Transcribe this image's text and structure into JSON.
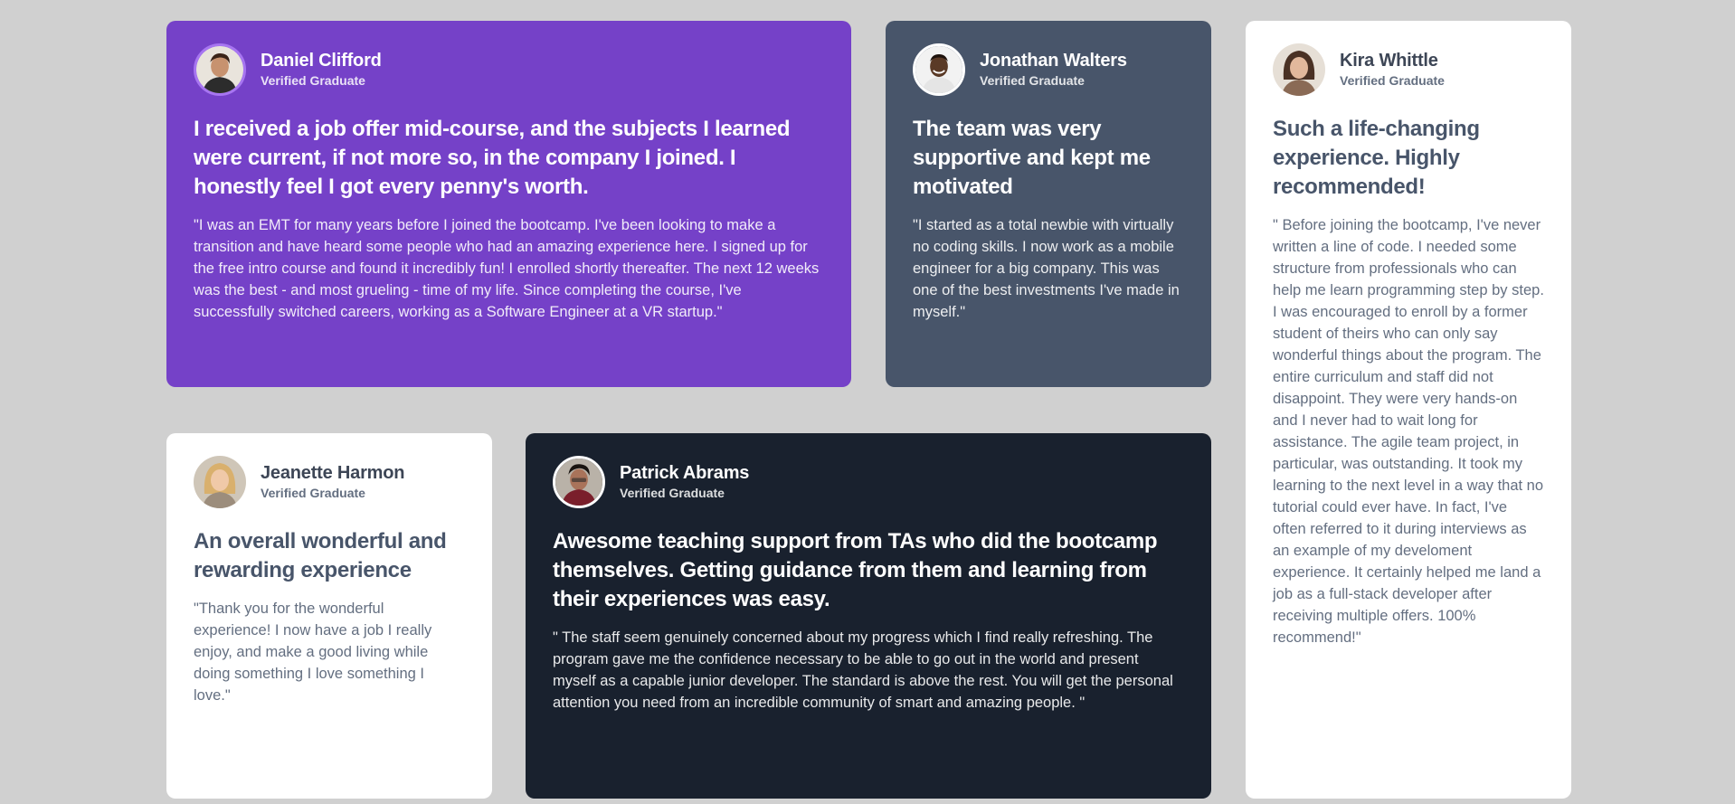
{
  "testimonials": {
    "daniel": {
      "name": "Daniel Clifford",
      "status": "Verified Graduate",
      "headline": "I received a job offer mid-course, and the subjects I learned were current, if not more so, in the company I joined. I honestly feel I got every penny's worth.",
      "quote": "\"I was an EMT for many years before I joined the bootcamp. I've been looking to make a transition and have heard some people who had an amazing experience here. I signed up for the free intro course and found it incredibly fun! I enrolled shortly thereafter. The next 12 weeks was the best - and most grueling - time of my life. Since completing the course, I've successfully switched careers, working as a Software Engineer at a VR startup.\"",
      "avatar_icon": "person-avatar-icon"
    },
    "jonathan": {
      "name": "Jonathan Walters",
      "status": "Verified Graduate",
      "headline": "The team was very supportive and kept me motivated",
      "quote": "\"I started as a total newbie with virtually no coding skills. I now work as a mobile engineer for a big company. This was one of the best investments I've made in myself.\"",
      "avatar_icon": "person-avatar-icon"
    },
    "kira": {
      "name": "Kira Whittle",
      "status": "Verified Graduate",
      "headline": "Such a life-changing experience. Highly recommended!",
      "quote": "\" Before joining the bootcamp, I've never written a line of code. I needed some structure from professionals who can help me learn programming step by step. I was encouraged to enroll by a former student of theirs who can only say wonderful things about the program. The entire curriculum and staff did not disappoint. They were very hands-on and I never had to wait long for assistance. The agile team project, in particular, was outstanding. It took my learning to the next level in a way that no tutorial could ever have. In fact, I've often referred to it during interviews as an example of my develoment experience. It certainly helped me land a job as a full-stack developer after receiving multiple offers. 100% recommend!\"",
      "avatar_icon": "person-avatar-icon"
    },
    "jeanette": {
      "name": "Jeanette Harmon",
      "status": "Verified Graduate",
      "headline": "An overall wonderful and rewarding experience",
      "quote": "\"Thank you for the wonderful experience! I now have a job I really enjoy, and make a good living while doing something I love something I love.\"",
      "avatar_icon": "person-avatar-icon"
    },
    "patrick": {
      "name": "Patrick Abrams",
      "status": "Verified Graduate",
      "headline": "Awesome teaching support from TAs who did the bootcamp themselves. Getting guidance from them and learning from their experiences was easy.",
      "quote": "\" The staff seem genuinely concerned about my progress which I find really refreshing. The program gave me the confidence necessary to be able to go out in the world and present myself as a capable junior developer. The standard is above the rest. You will get the personal attention you need from an incredible community of smart and amazing people. \"",
      "avatar_icon": "person-avatar-icon"
    }
  },
  "colors": {
    "page_background": "#d0d0d0",
    "moderate_violet": "#7541c8",
    "grayish_blue": "#48556a",
    "very_dark_blackish_blue": "#19212e",
    "white": "#ffffff"
  }
}
